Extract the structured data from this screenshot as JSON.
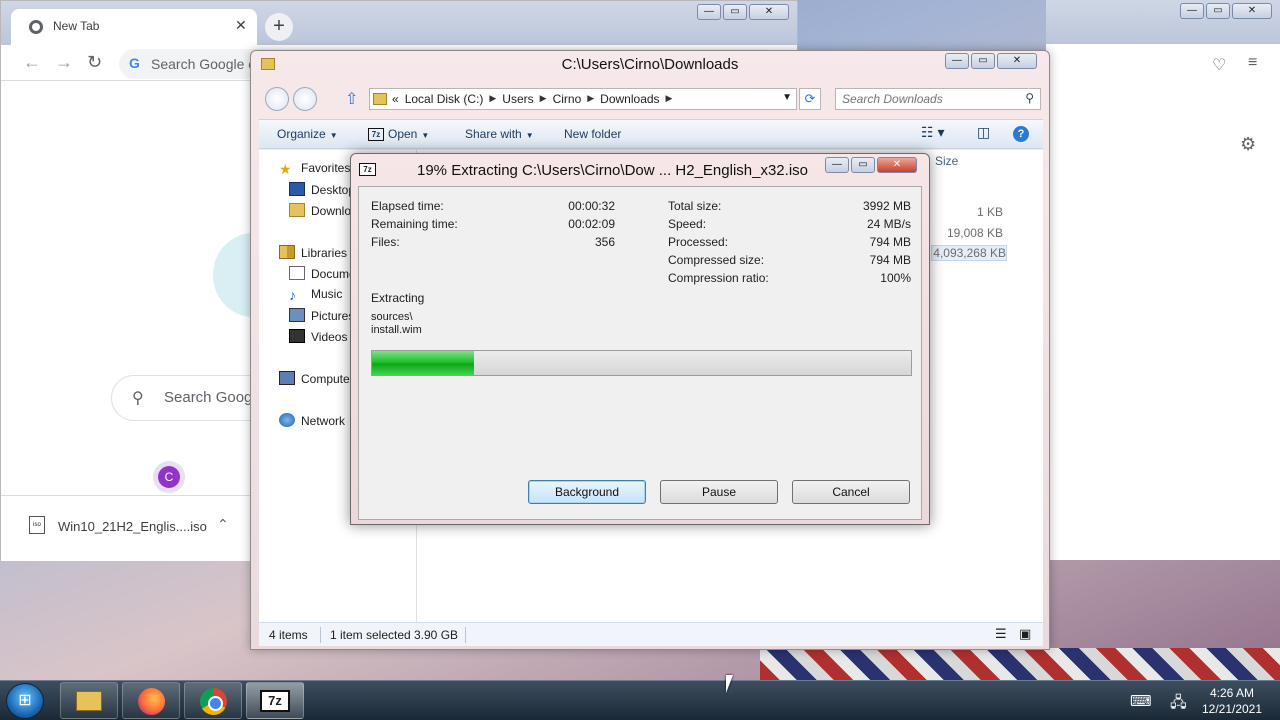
{
  "chrome": {
    "tab_title": "New Tab",
    "tab_close": "✕",
    "new_tab": "+",
    "omnibox_placeholder": "Search Google o",
    "ntp_search_placeholder": "Search Goog",
    "avatar_letter": "C",
    "download_item": "Win10_21H2_Englis....iso",
    "download_icon_label": "iso",
    "window_buttons": {
      "minimize": "—",
      "maximize": "▭",
      "close": "✕"
    }
  },
  "explorer": {
    "title": "C:\\Users\\Cirno\\Downloads",
    "breadcrumb": {
      "prefix": "«",
      "items": [
        "Local Disk (C:)",
        "Users",
        "Cirno",
        "Downloads"
      ]
    },
    "search_placeholder": "Search Downloads",
    "commands": {
      "organize": "Organize",
      "open": "Open",
      "open_icon_label": "7z",
      "share_with": "Share with",
      "new_folder": "New folder"
    },
    "nav": {
      "favorites": "Favorites",
      "desktop": "Desktop",
      "downloads": "Downlo",
      "libraries": "Libraries",
      "documents": "Docume",
      "music": "Music",
      "pictures": "Pictures",
      "videos": "Videos",
      "computer": "Compute",
      "network": "Network"
    },
    "column_size": "Size",
    "file_sizes": [
      "1 KB",
      "19,008 KB",
      "4,093,268 KB"
    ],
    "status": {
      "items_count": "4 items",
      "selected": "1 item selected",
      "selected_size": "3.90 GB"
    },
    "window_buttons": {
      "minimize": "—",
      "maximize": "▭",
      "close": "✕"
    }
  },
  "dialog": {
    "title": "19% Extracting C:\\Users\\Cirno\\Dow ... H2_English_x32.iso",
    "icon_label": "7z",
    "window_buttons": {
      "minimize": "—",
      "maximize": "▭",
      "close": "✕"
    },
    "left_stats": [
      {
        "label": "Elapsed time:",
        "value": "00:00:32"
      },
      {
        "label": "Remaining time:",
        "value": "00:02:09"
      },
      {
        "label": "Files:",
        "value": "356"
      }
    ],
    "right_stats": [
      {
        "label": "Total size:",
        "value": "3992 MB"
      },
      {
        "label": "Speed:",
        "value": "24 MB/s"
      },
      {
        "label": "Processed:",
        "value": "794 MB"
      },
      {
        "label": "Compressed size:",
        "value": "794 MB"
      },
      {
        "label": "Compression ratio:",
        "value": "100%"
      }
    ],
    "operation": "Extracting",
    "current_path": "sources\\",
    "current_file": "install.wim",
    "progress_fraction": 0.19,
    "buttons": {
      "background": "Background",
      "pause": "Pause",
      "cancel": "Cancel"
    }
  },
  "taskbar": {
    "open_icon_label": "7z",
    "clock_time": "4:26 AM",
    "clock_date": "12/21/2021"
  }
}
